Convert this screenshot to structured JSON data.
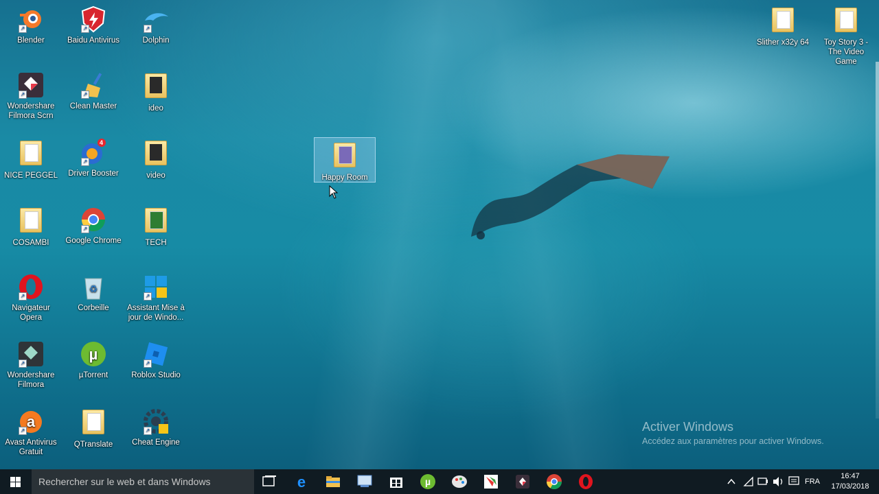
{
  "desktop_icons": [
    {
      "label": "Blender"
    },
    {
      "label": "Baidu Antivirus"
    },
    {
      "label": "Dolphin"
    },
    {
      "label": "Wondershare Filmora Scrn"
    },
    {
      "label": "Clean Master"
    },
    {
      "label": "ideo"
    },
    {
      "label": "NICE PEGGEL"
    },
    {
      "label": "Driver Booster",
      "badge": "4"
    },
    {
      "label": "video"
    },
    {
      "label": "COSAMBI"
    },
    {
      "label": "Google Chrome"
    },
    {
      "label": "TECH"
    },
    {
      "label": "Navigateur Opera"
    },
    {
      "label": "Corbeille"
    },
    {
      "label": "Assistant Mise à jour de Windo..."
    },
    {
      "label": "Wondershare Filmora"
    },
    {
      "label": "µTorrent"
    },
    {
      "label": "Roblox Studio"
    },
    {
      "label": "Avast Antivirus Gratuit"
    },
    {
      "label": "QTranslate"
    },
    {
      "label": "Cheat Engine"
    },
    {
      "label": "Happy Room"
    },
    {
      "label": "Slither x32y 64"
    },
    {
      "label": "Toy Story 3 - The Video Game"
    }
  ],
  "watermark": {
    "title": "Activer Windows",
    "subtitle": "Accédez aux paramètres pour activer Windows."
  },
  "taskbar": {
    "search_placeholder": "Rechercher sur le web et dans Windows",
    "pinned": [
      "task-view-icon",
      "edge-icon",
      "file-explorer-icon",
      "network-app-icon",
      "store-icon",
      "utorrent-icon",
      "paint-icon",
      "cursor-app-icon",
      "filmora-icon",
      "chrome-icon",
      "opera-icon"
    ],
    "language": "FRA",
    "time": "16:47",
    "date": "17/03/2018"
  },
  "colors": {
    "accent": "#0078d7",
    "taskbar": "#101b22",
    "water": "#178ba5"
  }
}
